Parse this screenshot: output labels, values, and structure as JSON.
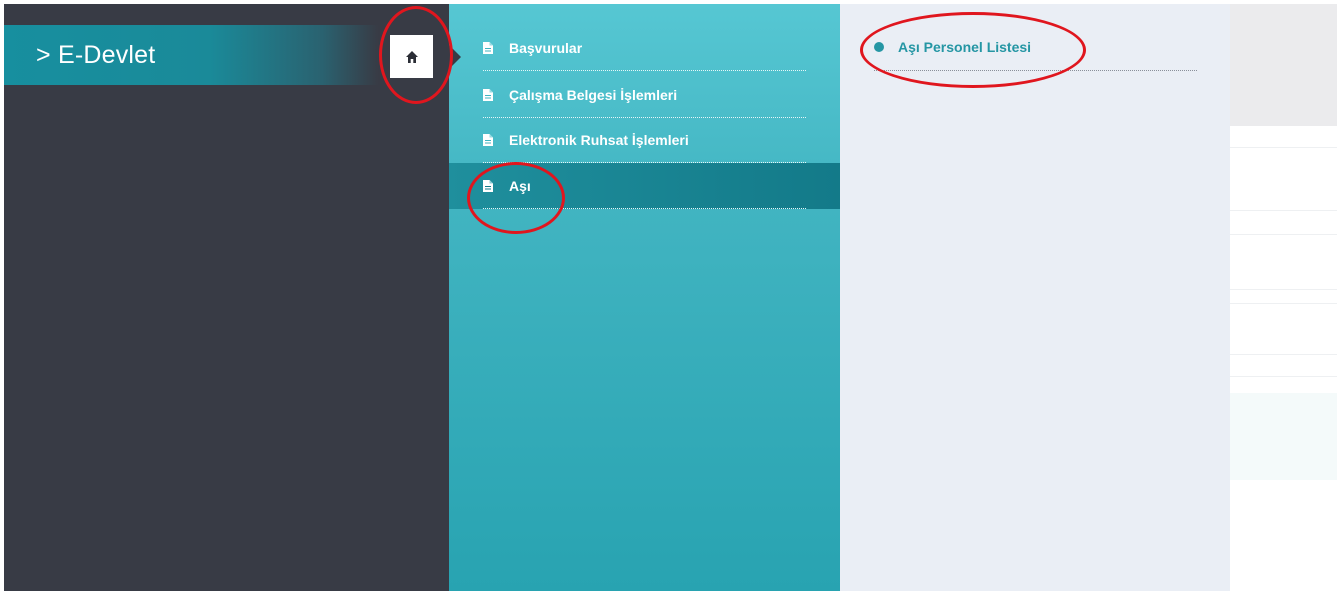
{
  "breadcrumb": {
    "label": "> E-Devlet"
  },
  "home_button": {
    "icon": "home-icon"
  },
  "menu": {
    "items": [
      {
        "label": "Başvurular",
        "icon": "document-icon",
        "active": false
      },
      {
        "label": "Çalışma Belgesi İşlemleri",
        "icon": "document-icon",
        "active": false
      },
      {
        "label": "Elektronik Ruhsat İşlemleri",
        "icon": "document-icon",
        "active": false
      },
      {
        "label": "Aşı",
        "icon": "document-icon",
        "active": true
      }
    ]
  },
  "submenu": {
    "items": [
      {
        "label": "Aşı Personel Listesi",
        "icon": "bullet-dot-icon"
      }
    ]
  },
  "colors": {
    "dark_panel": "#383b45",
    "teal_panel": "#41b4c1",
    "active_item": "#137a89",
    "light_panel": "#eaeef5",
    "accent_text": "#2596a4",
    "annotation": "#e0161e"
  }
}
